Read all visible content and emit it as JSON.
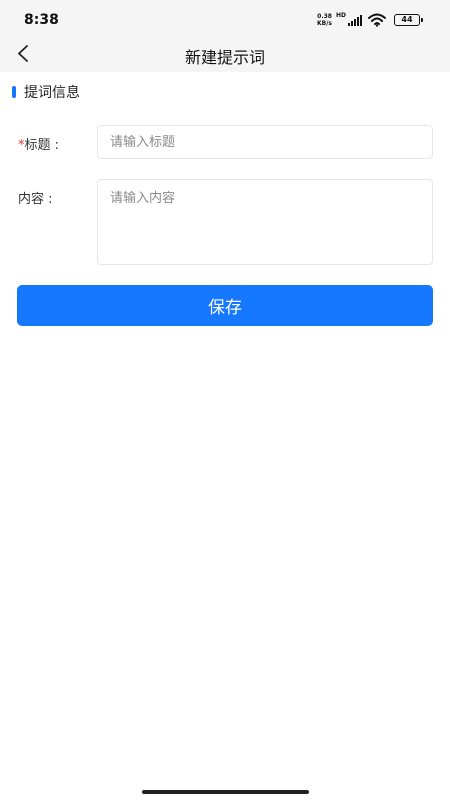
{
  "status_bar": {
    "time": "8:38",
    "net_speed_value": "0.38",
    "net_speed_unit": "KB/s",
    "hd_label": "HD",
    "battery_level": "44"
  },
  "nav": {
    "title": "新建提示词",
    "back_icon": "chevron-left-icon"
  },
  "section": {
    "title": "提词信息"
  },
  "form": {
    "title_label": "标题 :",
    "title_required_mark": "*",
    "title_placeholder": "请输入标题",
    "title_value": "",
    "content_label": "内容 :",
    "content_placeholder": "请输入内容",
    "content_value": ""
  },
  "actions": {
    "save_label": "保存"
  },
  "colors": {
    "accent": "#1677ff",
    "required": "#e53935",
    "header_bg": "#f5f5f5"
  }
}
